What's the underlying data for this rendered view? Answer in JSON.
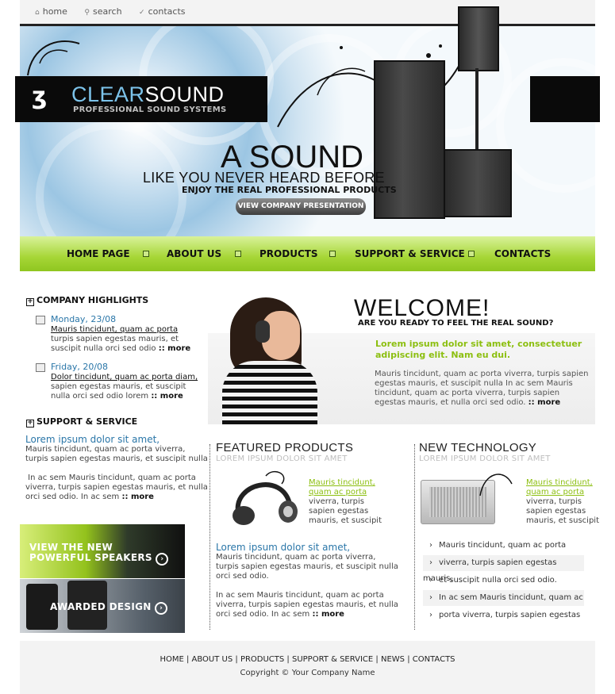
{
  "top_links": [
    {
      "label": "home",
      "icon": "home-icon"
    },
    {
      "label": "search",
      "icon": "search-icon"
    },
    {
      "label": "contacts",
      "icon": "contacts-icon"
    }
  ],
  "brand": {
    "name_part1": "CLEAR",
    "name_part2": "SOUND",
    "tagline": "PROFESSIONAL SOUND SYSTEMS"
  },
  "hero": {
    "line1": "A SOUND",
    "line2": "LIKE YOU NEVER HEARD BEFORE",
    "line3": "ENJOY THE REAL PROFESSIONAL PRODUCTS",
    "button": "VIEW COMPANY PRESENTATION"
  },
  "nav": [
    "HOME PAGE",
    "ABOUT US",
    "PRODUCTS",
    "SUPPORT & SERVICE",
    "CONTACTS"
  ],
  "highlights": {
    "title": "COMPANY HIGHLIGHTS",
    "items": [
      {
        "date": "Monday, 23/08",
        "link": "Mauris tincidunt, quam ac porta",
        "text1": "turpis sapien egestas mauris, et",
        "text2": "suscipit nulla orci sed odio",
        "more": ":: more"
      },
      {
        "date": "Friday, 20/08",
        "link": "Dolor tincidunt, quam ac porta diam,",
        "text1": "sapien egestas mauris, et suscipit",
        "text2": "nulla orci sed odio lorem",
        "more": ":: more"
      }
    ]
  },
  "support": {
    "title": "SUPPORT & SERVICE",
    "heading": "Lorem ipsum dolor sit amet,",
    "p1_l1": "Mauris tincidunt, quam ac porta viverra,",
    "p1_l2": "turpis sapien egestas mauris, et suscipit nulla",
    "p2_l1": " In ac sem Mauris tincidunt, quam ac porta",
    "p2_l2": "viverra, turpis sapien egestas mauris, et nulla",
    "p2_l3": "orci sed odio. In ac sem",
    "more": ":: more"
  },
  "promos": {
    "speakers_l1": "VIEW THE NEW",
    "speakers_l2": "POWERFUL SPEAKERS",
    "awarded": "AWARDED DESIGN"
  },
  "welcome": {
    "title": "WELCOME!",
    "subtitle": "ARE YOU READY TO FEEL THE REAL SOUND?",
    "green_l1": "Lorem ipsum dolor sit amet, consectetuer",
    "green_l2": "adipiscing elit. Nam eu dui.",
    "p_l1": "Mauris tincidunt, quam ac porta viverra, turpis sapien",
    "p_l2": "egestas mauris, et suscipit nulla In ac sem Mauris",
    "p_l3": "tincidunt, quam ac porta viverra, turpis sapien",
    "p_l4": "egestas mauris, et nulla orci sed odio.",
    "more": ":: more"
  },
  "featured": {
    "title": "FEATURED PRODUCTS",
    "sub": "LOREM IPSUM DOLOR SIT AMET",
    "link_l1": "Mauris tincidunt,",
    "link_l2": "quam ac porta",
    "t1": "viverra, turpis",
    "t2": "sapien egestas",
    "t3": "mauris, et suscipit",
    "heading": "Lorem ipsum dolor sit amet,",
    "p1_l1": "Mauris tincidunt, quam ac porta viverra,",
    "p1_l2": "turpis sapien egestas mauris, et suscipit nulla",
    "p1_l3": "orci sed odio.",
    "p2_l1": "In ac sem Mauris tincidunt, quam ac porta",
    "p2_l2": "viverra, turpis sapien egestas mauris, et nulla",
    "p2_l3": "orci sed odio. In ac sem",
    "more": ":: more"
  },
  "newtech": {
    "title": "NEW TECHNOLOGY",
    "sub": "LOREM IPSUM DOLOR SIT AMET",
    "link_l1": "Mauris tincidunt,",
    "link_l2": "quam ac porta",
    "t1": "viverra, turpis",
    "t2": "sapien egestas",
    "t3": "mauris, et suscipit",
    "list": [
      "Mauris tincidunt, quam ac porta",
      "viverra, turpis sapien egestas mauris,",
      "et suscipit nulla orci sed odio.",
      "In ac sem Mauris tincidunt, quam ac",
      "porta viverra, turpis sapien egestas"
    ]
  },
  "footer": {
    "links": [
      "HOME",
      "ABOUT US",
      "PRODUCTS",
      "SUPPORT & SERVICE",
      "NEWS",
      "CONTACTS"
    ],
    "copyright": "Copyright © Your Company Name"
  },
  "colors": {
    "accent_green": "#8cbf10",
    "link_blue": "#2a76a8",
    "logo_blue": "#7cc3ea"
  }
}
